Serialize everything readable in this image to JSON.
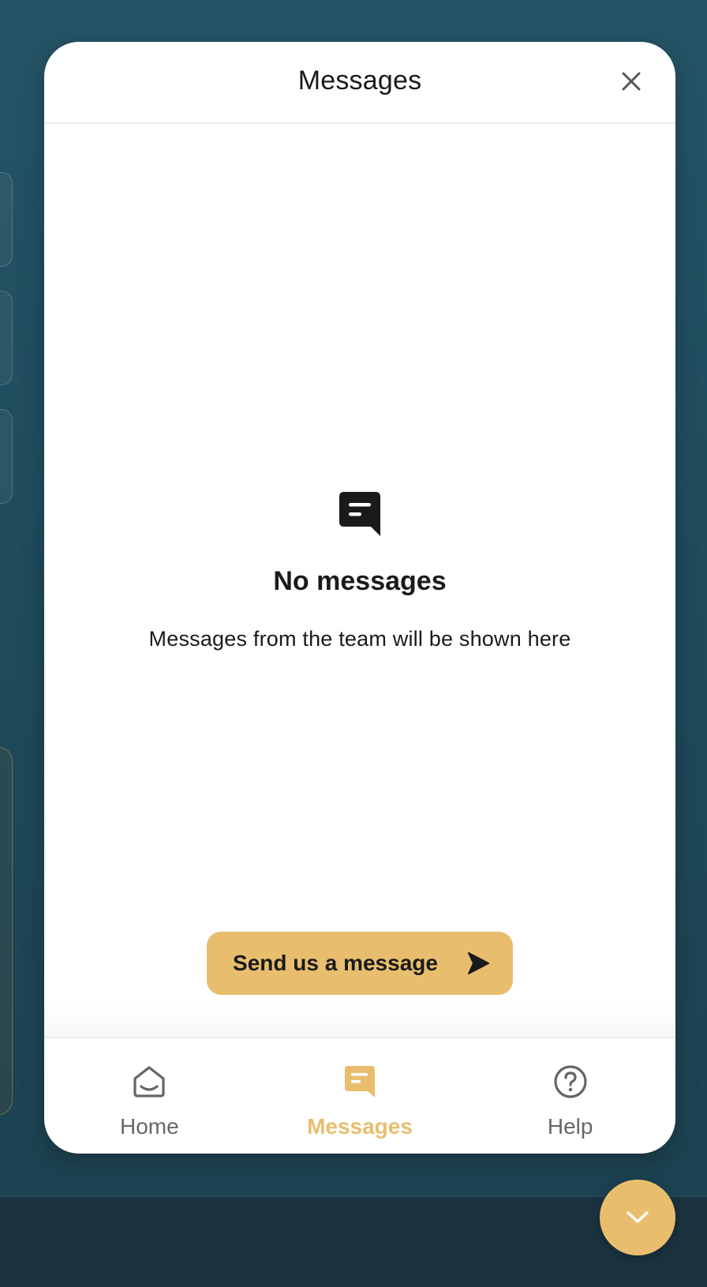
{
  "header": {
    "title": "Messages"
  },
  "empty_state": {
    "title": "No messages",
    "description": "Messages from the team will be shown here"
  },
  "cta": {
    "label": "Send us a message"
  },
  "nav": {
    "items": [
      {
        "label": "Home",
        "icon": "home-icon",
        "active": false
      },
      {
        "label": "Messages",
        "icon": "messages-icon",
        "active": true
      },
      {
        "label": "Help",
        "icon": "help-icon",
        "active": false
      }
    ]
  },
  "colors": {
    "accent": "#e8be6e",
    "text": "#1a1a1a",
    "muted": "#666666",
    "background": "#245466"
  }
}
